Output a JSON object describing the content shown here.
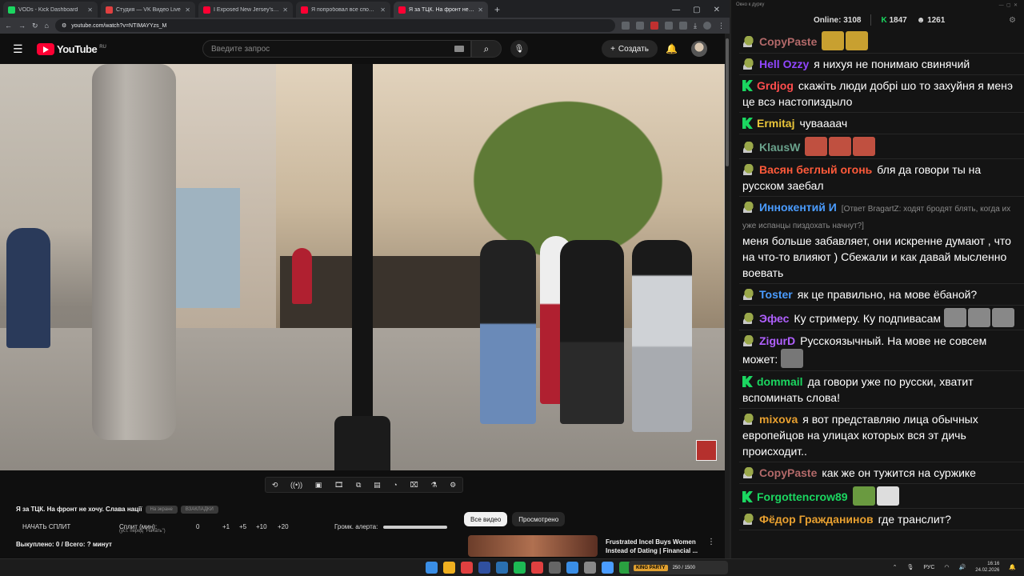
{
  "browser": {
    "tabs": [
      {
        "title": "VODs - Kick Dashboard",
        "favicon_color": "#1bd660"
      },
      {
        "title": "Студия — VK Видео Live",
        "favicon_color": "#e04040"
      },
      {
        "title": "I Exposed New Jersey's Jewish",
        "favicon_color": "#ff0033"
      },
      {
        "title": "Я попробовал все способы б",
        "favicon_color": "#ff0033"
      },
      {
        "title": "Я за ТЦК. На фронт не хоч",
        "favicon_color": "#ff0033",
        "active": true
      }
    ],
    "url": "youtube.com/watch?v=NTIMAYYzs_M"
  },
  "youtube": {
    "logo_text": "YouTube",
    "region": "RU",
    "search_placeholder": "Введите запрос",
    "create_label": "Создать"
  },
  "player": {
    "control_icons": [
      "loop-icon",
      "broadcast-icon",
      "screenshot-icon",
      "film-icon",
      "pip-icon",
      "subtitles-icon",
      "speed-icon",
      "camera-icon",
      "lab-icon",
      "settings-icon"
    ],
    "video_title": "Я за ТЦК. На фронт не хочу. Слава нації",
    "pill1": "На экране",
    "pill2": "ВЗАКЛАДКИ",
    "split_button": "НАЧАТЬ СПЛИТ",
    "split_label": "Сплит (мин):",
    "split_hint": "(уст. перед \"Начать\")",
    "split_value": "0",
    "inc1": "+1",
    "inc5": "+5",
    "inc10": "+10",
    "inc20": "+20",
    "alert_label": "Громк. алерта:",
    "counter": "Выкуплено: 0 / Всего: ? минут"
  },
  "recommendations": {
    "chip_all": "Все видео",
    "chip_watched": "Просмотрено",
    "item_title": "Frustrated Incel Buys Women Instead of Dating | Financial ..."
  },
  "chat": {
    "window_title": "Окно к дурку",
    "online_label": "Online:",
    "online_count": "3108",
    "kick_count": "1847",
    "other_count": "1261",
    "messages": [
      {
        "badge": "pepe",
        "name": "CopyPaste",
        "color": "#b26969",
        "text": "",
        "emotes": [
          "#c8a030",
          "#c8a030"
        ]
      },
      {
        "badge": "pepe",
        "name": "Hell Ozzy",
        "color": "#9146ff",
        "text": "я нихуя не понимаю свинячий"
      },
      {
        "badge": "kick",
        "name": "Grdjog",
        "color": "#ff4d4d",
        "text": "скажіть люди добрі шо то захуйня я менэ це всэ настопиздыло"
      },
      {
        "badge": "kick",
        "name": "Ermitaj",
        "color": "#e8c43a",
        "text": "чуваааач"
      },
      {
        "badge": "pepe",
        "name": "KlausW",
        "color": "#6aa28c",
        "text": "",
        "emotes": [
          "#c05040",
          "#c05040",
          "#c05040"
        ]
      },
      {
        "badge": "pepe",
        "name": "Васян беглый огонь",
        "color": "#ff5a3a",
        "text": "бля да говори ты на русском заебал"
      },
      {
        "badge": "pepe",
        "name": "Иннокентий И",
        "color": "#4a9cff",
        "reply": "[Ответ BragartZ: ходят бродят блять, когда их уже испанцы пиздохать начнут?]",
        "text": "меня больше забавляет, они искренне думают , что на что-то влияют ) Сбежали и как давай мысленно воевать"
      },
      {
        "badge": "pepe",
        "name": "Toster",
        "color": "#4a9cff",
        "text": "як це правильно, на мове ёбаной?"
      },
      {
        "badge": "pepe",
        "name": "Эфес",
        "color": "#b060ff",
        "text": "Ку стримеру. Ку подпивасам",
        "emotes": [
          "#888",
          "#888",
          "#888"
        ]
      },
      {
        "badge": "pepe",
        "name": "ZigurD",
        "color": "#b060ff",
        "text": "Русскоязычный. На мове не совсем может:",
        "emotes": [
          "#777"
        ]
      },
      {
        "badge": "kick",
        "name": "dommail",
        "color": "#1bd660",
        "text": "да говори уже по русски, хватит вспоминать слова!"
      },
      {
        "badge": "pepe",
        "name": "mixova",
        "color": "#e8a030",
        "text": "я вот представляю лица обычных европейцов на улицах которых вся эт дичь происходит.."
      },
      {
        "badge": "pepe",
        "name": "CopyPaste",
        "color": "#b26969",
        "text": "как же он тужится на суржике"
      },
      {
        "badge": "kick",
        "name": "Forgottencrow89",
        "color": "#1bd660",
        "text": "",
        "emotes": [
          "#6a9a40",
          "#ddd"
        ]
      },
      {
        "badge": "pepe",
        "name": "Фёдор Гражданинов",
        "color": "#e8a030",
        "text": "где транслит?"
      }
    ]
  },
  "taskbar": {
    "icon_colors": [
      "#3a8ee6",
      "#f0b020",
      "#e04040",
      "#3050a0",
      "#2a6fb0",
      "#1db954",
      "#e04040",
      "#666",
      "#3a8ee6",
      "#888",
      "#4a9cff",
      "#2aa040"
    ],
    "king_label": "KING PARTY",
    "king_text": "250 / 1500",
    "lang": "РУС",
    "time": "16:16",
    "date": "24.02.2026"
  }
}
